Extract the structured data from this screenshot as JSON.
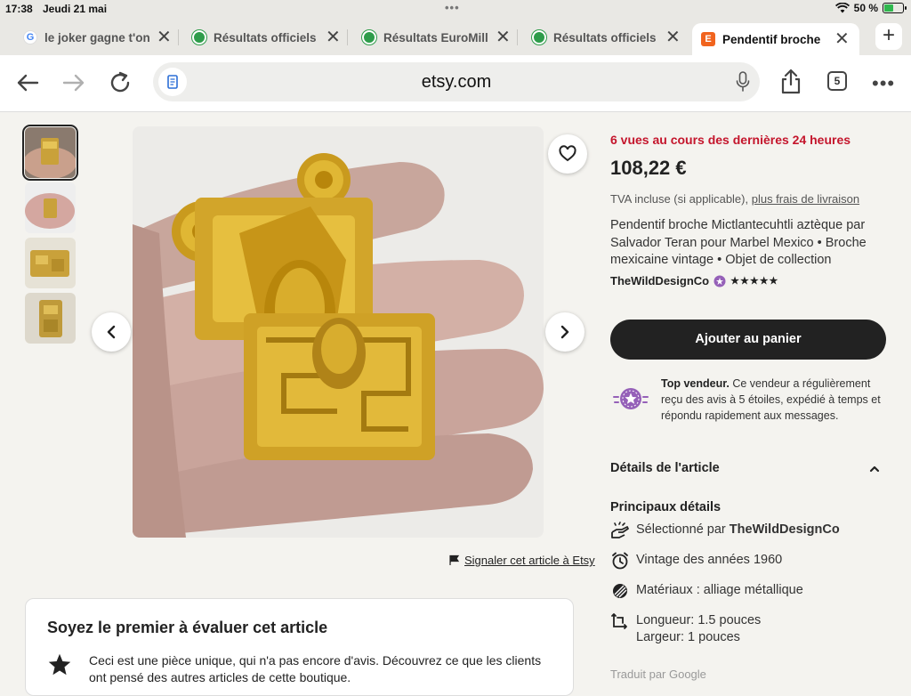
{
  "status": {
    "time": "17:38",
    "date": "Jeudi 21 mai",
    "battery": "50 %",
    "battery_level": 0.5
  },
  "tabs": [
    {
      "label": "le joker gagne t'on",
      "icon": "google-icon",
      "active": false
    },
    {
      "label": "Résultats officiels",
      "icon": "site-icon",
      "active": false
    },
    {
      "label": "Résultats EuroMillions",
      "icon": "site-icon",
      "active": false
    },
    {
      "label": "Résultats officiels",
      "icon": "site-icon",
      "active": false
    },
    {
      "label": "Pendentif broche",
      "icon": "etsy-icon",
      "active": true
    }
  ],
  "toolbar": {
    "url": "etsy.com",
    "tab_count": "5"
  },
  "gallery": {
    "thumbnail_count": 4,
    "selected": 1
  },
  "product": {
    "views": "6 vues au cours des dernières 24 heures",
    "price": "108,22 €",
    "vat_prefix": "TVA incluse (si applicable), ",
    "vat_link": "plus frais de livraison",
    "title": "Pendentif broche Mictlantecuhtli aztèque par Salvador Teran pour Marbel Mexico • Broche mexicaine vintage • Objet de collection",
    "shop": "TheWildDesignCo",
    "stars": "★★★★★",
    "rating": 5,
    "add_to_cart": "Ajouter au panier"
  },
  "seller": {
    "label": "Top vendeur.",
    "text": " Ce vendeur a régulièrement reçu des avis à 5 étoiles, expédié à temps et répondu rapidement aux messages."
  },
  "details": {
    "heading": "Détails de l'article",
    "subheading": "Principaux détails",
    "selected_prefix": "Sélectionné par ",
    "selected_shop": "TheWildDesignCo",
    "vintage": "Vintage des années 1960",
    "materials": "Matériaux : alliage métallique",
    "length": "Longueur: 1.5 pouces",
    "width": "Largeur: 1 pouces",
    "translated": "Traduit par Google"
  },
  "report": "Signaler cet article à Etsy",
  "reviews": {
    "title": "Soyez le premier à évaluer cet article",
    "text": "Ceci est une pièce unique, qui n'a pas encore d'avis. Découvrez ce que les clients ont pensé des autres articles de cette boutique."
  },
  "colors": {
    "accent_red": "#c4152c",
    "button_dark": "#222222",
    "etsy_orange": "#f1641e",
    "seller_purple": "#9560b8"
  }
}
